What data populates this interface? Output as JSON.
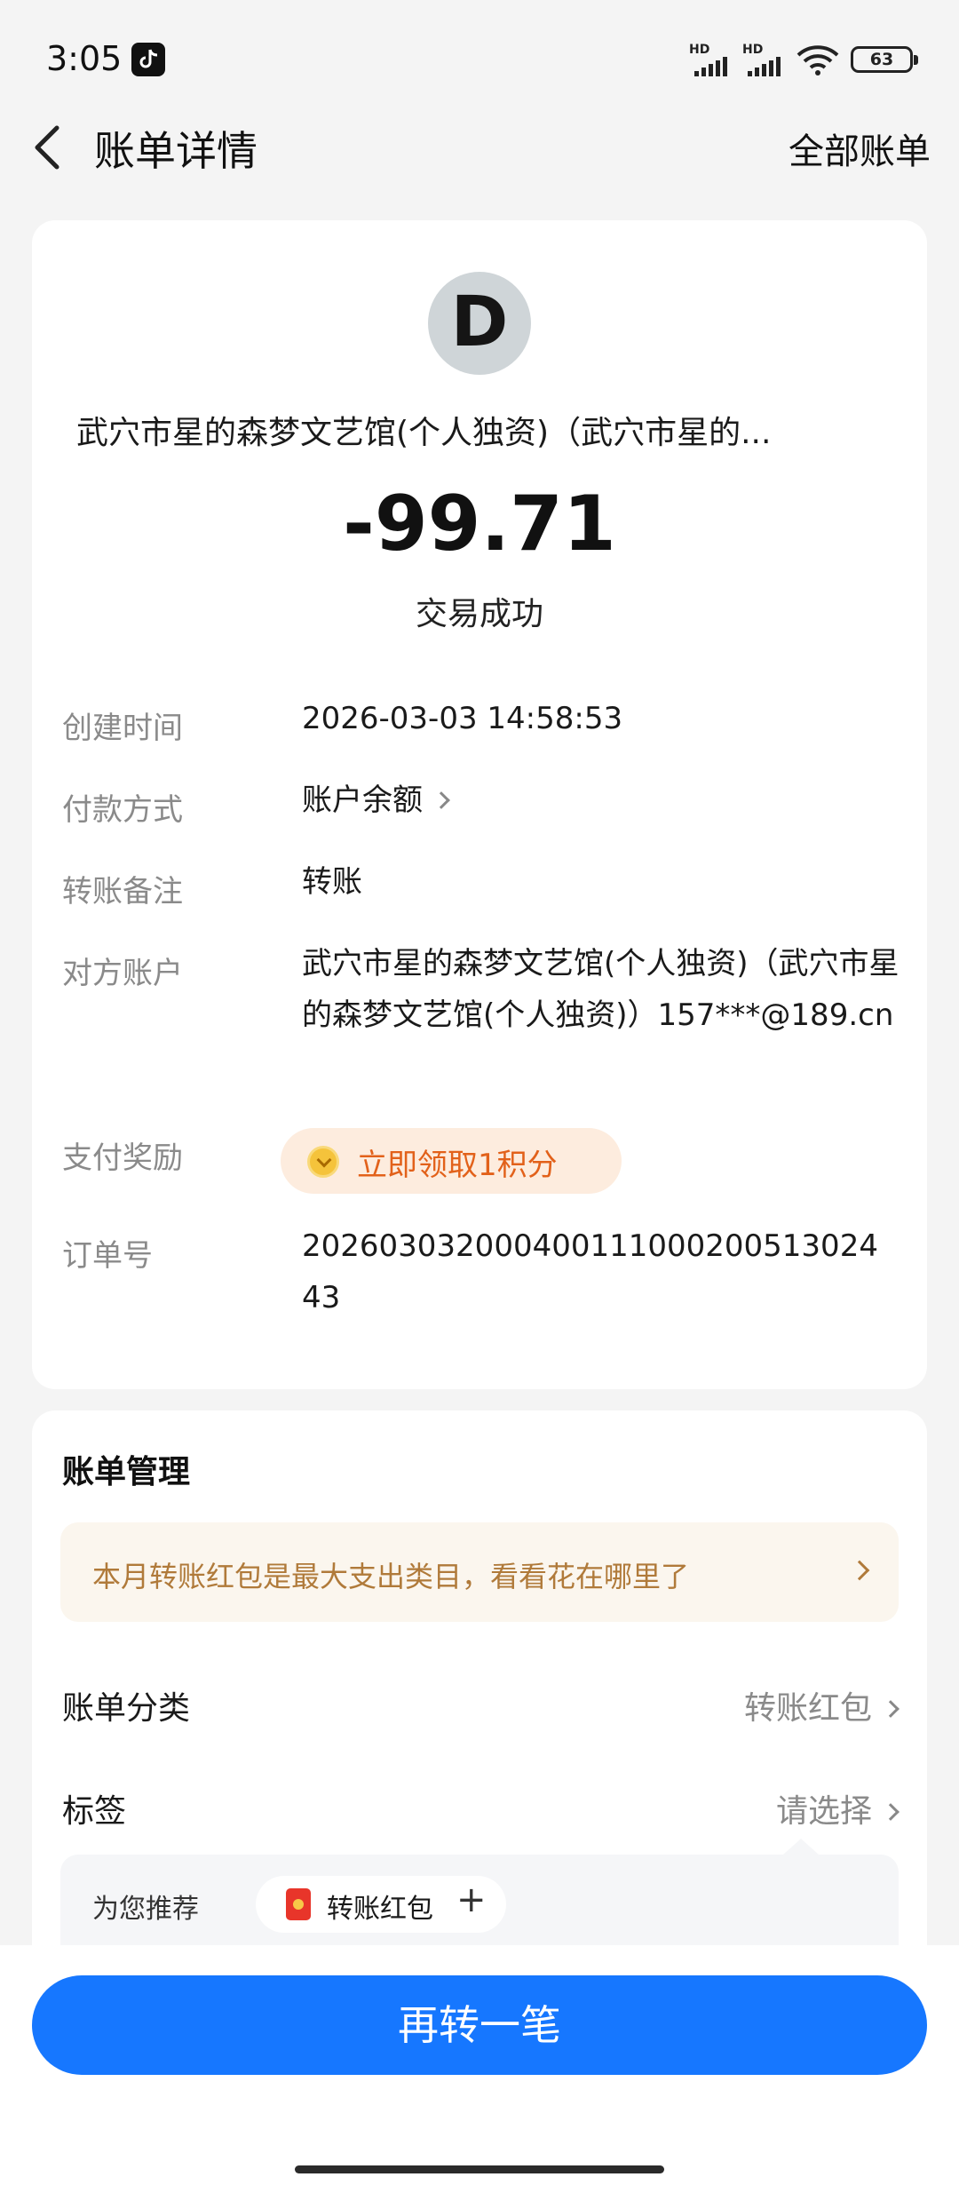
{
  "status_bar": {
    "time": "3:05",
    "battery": "63",
    "sim1": "HD",
    "sim2": "HD"
  },
  "header": {
    "title": "账单详情",
    "all_bills": "全部账单"
  },
  "summary": {
    "avatar_letter": "D",
    "merchant": "武穴市星的森梦文艺馆(个人独资)（武穴市星的...",
    "amount": "-99.71",
    "status": "交易成功"
  },
  "details": {
    "created_label": "创建时间",
    "created_value": "2026-03-03 14:58:53",
    "payment_label": "付款方式",
    "payment_value": "账户余额",
    "remark_label": "转账备注",
    "remark_value": "转账",
    "counterparty_label": "对方账户",
    "counterparty_value": "武穴市星的森梦文艺馆(个人独资)（武穴市星的森梦文艺馆(个人独资)）157***@189.cn",
    "reward_label": "支付奖励",
    "reward_value": "立即领取1积分",
    "order_label": "订单号",
    "order_value": "20260303200040011100020051302443"
  },
  "management": {
    "title": "账单管理",
    "tip": "本月转账红包是最大支出类目，看看花在哪里了",
    "category_label": "账单分类",
    "category_value": "转账红包",
    "tag_label": "标签",
    "tag_value": "请选择",
    "recommend_label": "为您推荐",
    "recommend_chip": "转账红包",
    "recommend_plus": "+"
  },
  "cta": {
    "label": "再转一笔"
  },
  "colors": {
    "primary": "#1677ff",
    "reward": "#e2611a",
    "tip": "#b07a3a"
  }
}
